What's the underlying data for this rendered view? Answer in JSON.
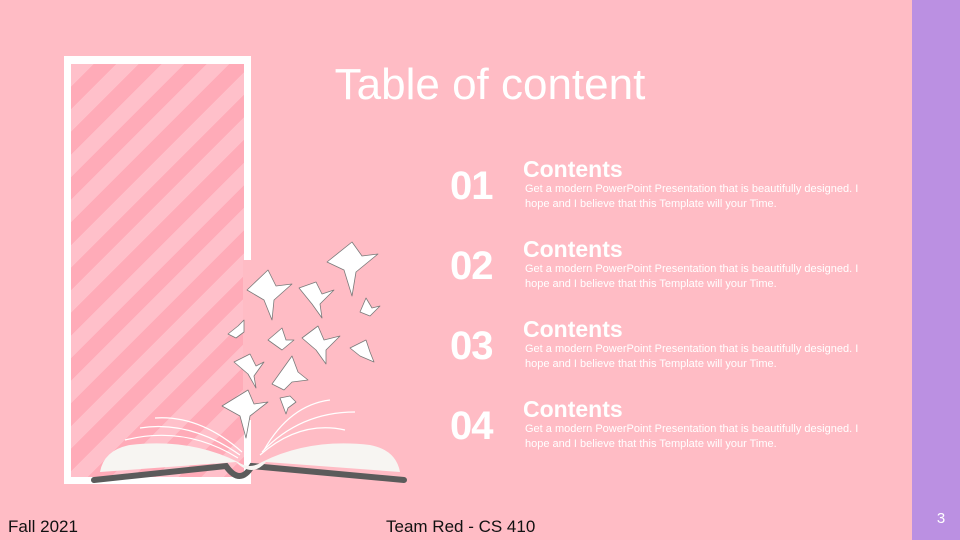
{
  "slide": {
    "title": "Table of content",
    "number": "3",
    "items": [
      {
        "number": "01",
        "heading": "Contents",
        "description": "Get a modern PowerPoint  Presentation that is beautifully designed. I hope and I believe that this Template will your Time."
      },
      {
        "number": "02",
        "heading": "Contents",
        "description": "Get a modern PowerPoint  Presentation that is beautifully designed. I hope and I believe that this Template will your Time."
      },
      {
        "number": "03",
        "heading": "Contents",
        "description": "Get a modern PowerPoint  Presentation that is beautifully designed. I hope and I believe that this Template will your Time."
      },
      {
        "number": "04",
        "heading": "Contents",
        "description": "Get a modern PowerPoint  Presentation that is beautifully designed. I hope and I believe that this Template will your Time."
      }
    ]
  },
  "footer": {
    "left": "Fall 2021",
    "center": "Team Red - CS 410"
  },
  "illustration": {
    "icons": [
      "open-book-icon",
      "origami-bird-icon"
    ],
    "colors": {
      "background": "#ffbcc5",
      "accent_bar": "#bb90e2",
      "frame": "#ffffff",
      "stripe": "#ffabb8",
      "book_cover": "#5b5b5b",
      "book_pages": "#f7f5f2"
    }
  }
}
